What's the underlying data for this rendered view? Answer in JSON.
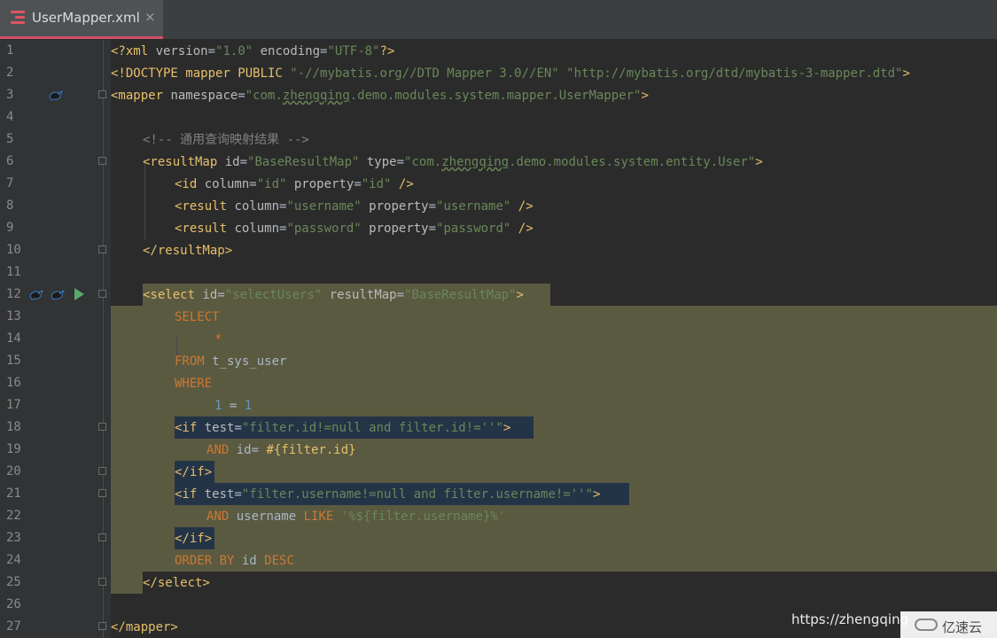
{
  "tab": {
    "title": "UserMapper.xml",
    "close": "×",
    "icon": "xml-file-icon"
  },
  "lines": [
    {
      "num": "1"
    },
    {
      "num": "2"
    },
    {
      "num": "3"
    },
    {
      "num": "4"
    },
    {
      "num": "5"
    },
    {
      "num": "6"
    },
    {
      "num": "7"
    },
    {
      "num": "8"
    },
    {
      "num": "9"
    },
    {
      "num": "10"
    },
    {
      "num": "11"
    },
    {
      "num": "12"
    },
    {
      "num": "13"
    },
    {
      "num": "14"
    },
    {
      "num": "15"
    },
    {
      "num": "16"
    },
    {
      "num": "17"
    },
    {
      "num": "18"
    },
    {
      "num": "19"
    },
    {
      "num": "20"
    },
    {
      "num": "21"
    },
    {
      "num": "22"
    },
    {
      "num": "23"
    },
    {
      "num": "24"
    },
    {
      "num": "25"
    },
    {
      "num": "26"
    },
    {
      "num": "27"
    }
  ],
  "code": {
    "l1": {
      "a": "<?xml ",
      "b": "version",
      "c": "=",
      "d": "\"1.0\"",
      "e": " encoding",
      "f": "=",
      "g": "\"UTF-8\"",
      "h": "?>"
    },
    "l2": {
      "a": "<!DOCTYPE mapper PUBLIC ",
      "b": "\"-//mybatis.org//DTD Mapper 3.0//EN\"",
      "c": " ",
      "d": "\"http://mybatis.org/dtd/mybatis-3-mapper.dtd\"",
      "e": ">"
    },
    "l3": {
      "a": "<mapper ",
      "b": "namespace",
      "c": "=",
      "d": "\"com.",
      "e": "zhengqing",
      "f": ".demo.modules.system.mapper.UserMapper\"",
      "g": ">"
    },
    "l5": {
      "a": "<!-- 通用查询映射结果 -->"
    },
    "l6": {
      "a": "<resultMap ",
      "b": "id",
      "c": "=",
      "d": "\"BaseResultMap\"",
      "e": " type",
      "f": "=",
      "g": "\"com.",
      "h": "zhengqing",
      "i": ".demo.modules.system.entity.User\"",
      "j": ">"
    },
    "l7": {
      "a": "<id ",
      "b": "column",
      "c": "=",
      "d": "\"id\"",
      "e": " property",
      "f": "=",
      "g": "\"id\"",
      "h": " />"
    },
    "l8": {
      "a": "<result ",
      "b": "column",
      "c": "=",
      "d": "\"username\"",
      "e": " property",
      "f": "=",
      "g": "\"username\"",
      "h": " />"
    },
    "l9": {
      "a": "<result ",
      "b": "column",
      "c": "=",
      "d": "\"password\"",
      "e": " property",
      "f": "=",
      "g": "\"password\"",
      "h": " />"
    },
    "l10": {
      "a": "</resultMap>"
    },
    "l12": {
      "a": "<select ",
      "b": "id",
      "c": "=",
      "d": "\"selectUsers\"",
      "e": " resultMap",
      "f": "=",
      "g": "\"BaseResultMap\"",
      "h": ">"
    },
    "l13": {
      "a": "SELECT"
    },
    "l14": {
      "a": "*"
    },
    "l15": {
      "a": "FROM",
      "b": " t_sys_user"
    },
    "l16": {
      "a": "WHERE"
    },
    "l17": {
      "a": "1",
      "b": " = ",
      "c": "1"
    },
    "l18": {
      "a": "<if ",
      "b": "test",
      "c": "=",
      "d": "\"filter.id!=null and filter.id!=''\"",
      "e": ">"
    },
    "l19": {
      "a": "AND",
      "b": " id= ",
      "c": "#{filter.id}"
    },
    "l20": {
      "a": "</if>"
    },
    "l21": {
      "a": "<if ",
      "b": "test",
      "c": "=",
      "d": "\"filter.username!=null and filter.username!=''\"",
      "e": ">"
    },
    "l22": {
      "a": "AND",
      "b": " username ",
      "c": "LIKE",
      "d": " ",
      "e": "'%${filter.username}%'"
    },
    "l23": {
      "a": "</if>"
    },
    "l24": {
      "a": "ORDER BY",
      "b": " id ",
      "c": "DESC"
    },
    "l25": {
      "a": "</select>"
    },
    "l27": {
      "a": "</mapper>"
    }
  },
  "watermark": {
    "url": "https://zhengqing",
    "logo": "亿速云"
  },
  "colors": {
    "tag": "#e8bf6a",
    "attr": "#bababa",
    "string": "#6a8759",
    "comment": "#808080",
    "keyword": "#cc7832",
    "number": "#6897bb",
    "selection": "#5a5a41",
    "tab_accent": "#d0506b"
  }
}
